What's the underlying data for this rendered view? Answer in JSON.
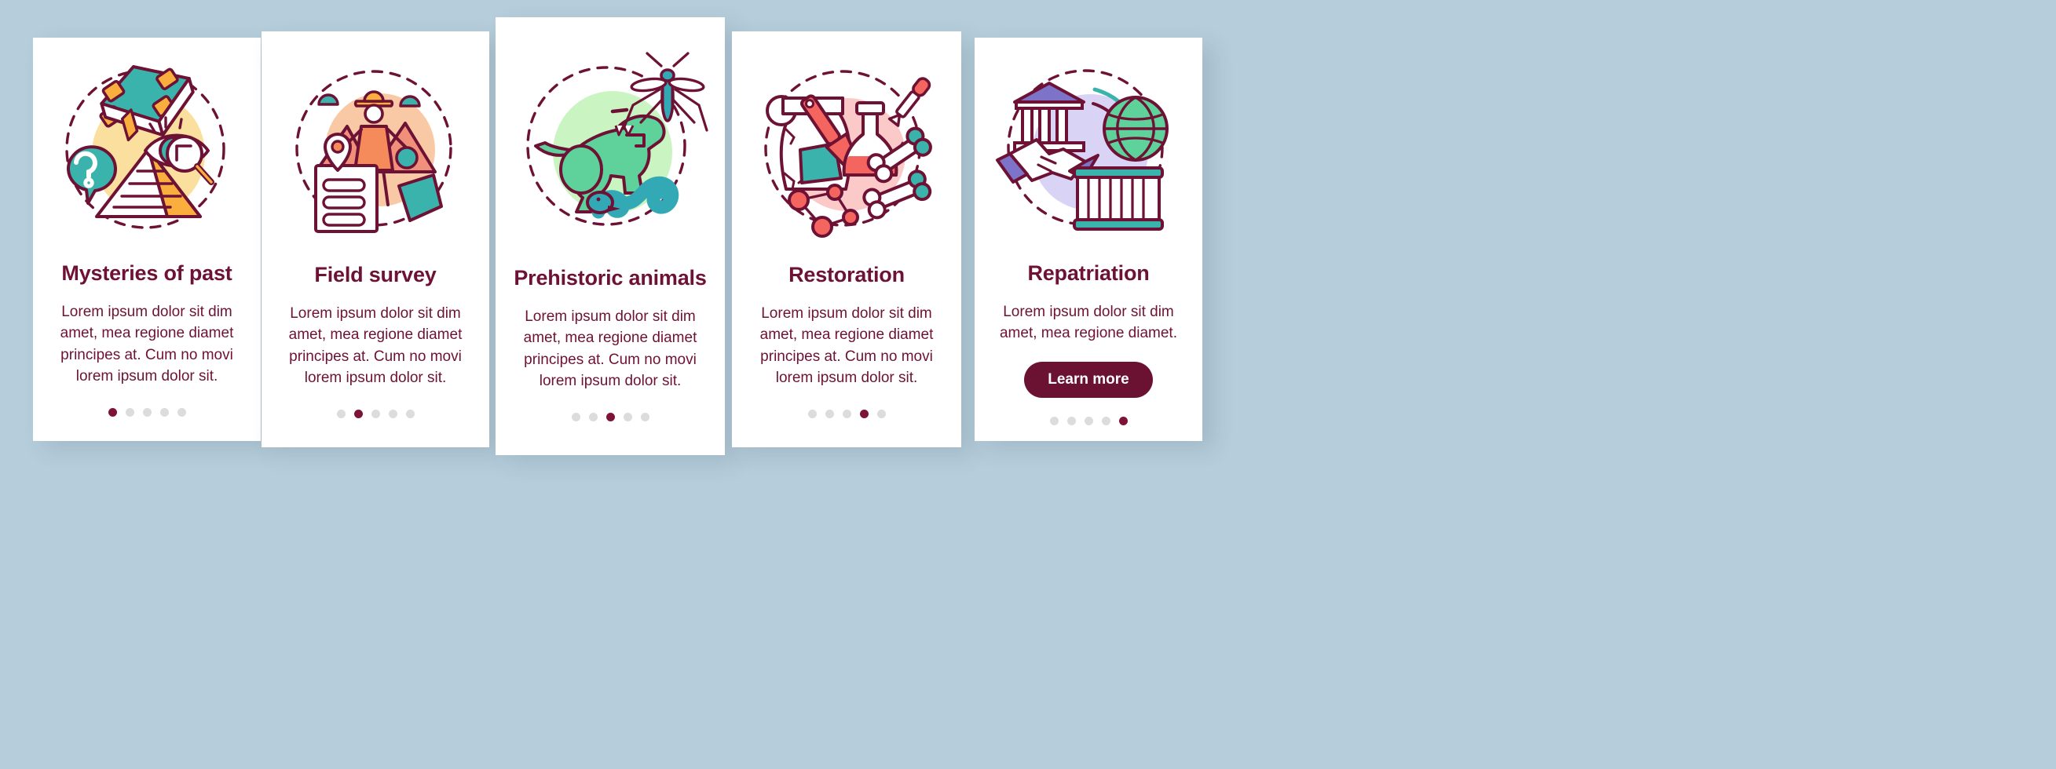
{
  "page": {
    "background_color": "#b6cedb",
    "accent_color": "#6e1235",
    "dot_inactive_color": "#dcdcde",
    "dot_active_color": "#7d1438"
  },
  "cards": [
    {
      "id": "mysteries-of-past",
      "title": "Mysteries of past",
      "body": "Lorem ipsum dolor sit dim amet, mea regione diamet principes at. Cum no movi lorem ipsum dolor sit.",
      "illustration": "book-question-pyramid-magnifier-icon",
      "blob_color": "#fbdf9e",
      "dots": {
        "count": 5,
        "active": 1
      },
      "button": null
    },
    {
      "id": "field-survey",
      "title": "Field survey",
      "body": "Lorem ipsum dolor sit dim amet, mea regione diamet principes at. Cum no movi lorem ipsum dolor sit.",
      "illustration": "explorer-map-clipboard-icon",
      "blob_color": "#f9c9a6",
      "dots": {
        "count": 5,
        "active": 2
      },
      "button": null
    },
    {
      "id": "prehistoric-animals",
      "title": "Prehistoric animals",
      "body": "Lorem ipsum dolor sit dim amet, mea regione diamet principes at. Cum no movi lorem ipsum dolor sit.",
      "illustration": "dinosaur-snake-mosquito-icon",
      "blob_color": "#caf5c3",
      "dots": {
        "count": 5,
        "active": 3
      },
      "button": null
    },
    {
      "id": "restoration",
      "title": "Restoration",
      "body": "Lorem ipsum dolor sit dim amet, mea regione diamet principes at. Cum no movi lorem ipsum dolor sit.",
      "illustration": "vase-brush-flask-bones-icon",
      "blob_color": "#fcc9c9",
      "dots": {
        "count": 5,
        "active": 4
      },
      "button": null
    },
    {
      "id": "repatriation",
      "title": "Repatriation",
      "body": "Lorem ipsum dolor sit dim amet, mea regione diamet.",
      "illustration": "museum-handshake-globe-crate-icon",
      "blob_color": "#d9d3f6",
      "dots": {
        "count": 5,
        "active": 5
      },
      "button": {
        "label": "Learn more"
      }
    }
  ],
  "palette": {
    "outline": "#6e1235",
    "teal": "#3bb3ad",
    "orange": "#f9ae3e",
    "green": "#5fd19a",
    "blue_teal": "#33a9b5",
    "coral": "#f4655f",
    "purple": "#7d74c9",
    "white": "#ffffff"
  }
}
